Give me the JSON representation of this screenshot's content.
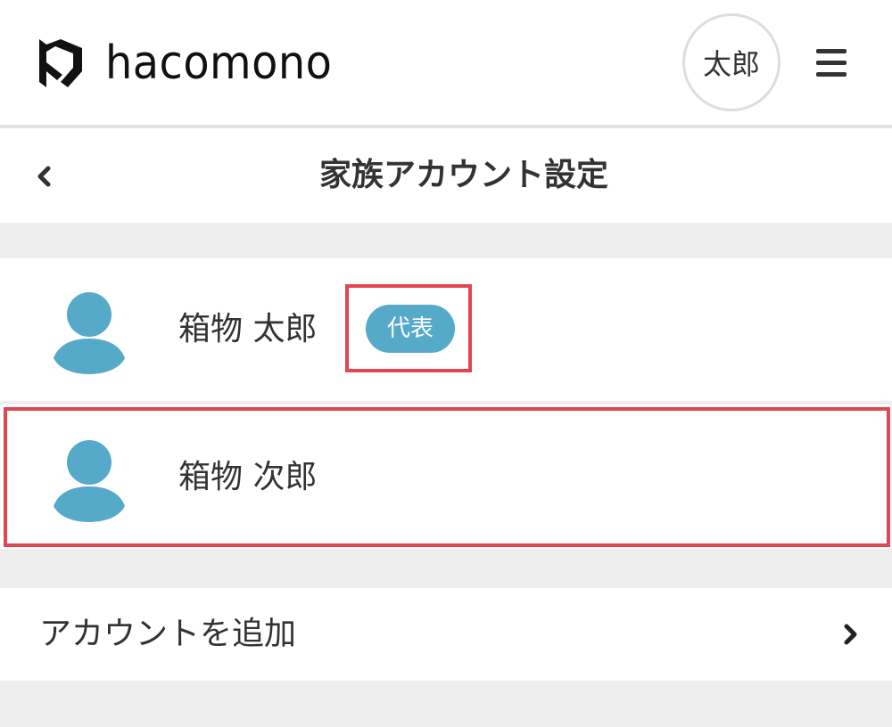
{
  "header": {
    "logo_text": "hacomono",
    "user_initials": "太郎"
  },
  "page": {
    "title": "家族アカウント設定"
  },
  "members": [
    {
      "name": "箱物 太郎",
      "badge": "代表"
    },
    {
      "name": "箱物 次郎"
    }
  ],
  "actions": {
    "add_account_label": "アカウントを追加"
  },
  "colors": {
    "accent": "#55a9c9",
    "highlight": "#e0474f",
    "text": "#333333",
    "background": "#eeeeee"
  },
  "icons": {
    "logo": "hacomono-logo-icon",
    "menu": "hamburger-menu-icon",
    "back": "chevron-left-icon",
    "member": "person-icon",
    "forward": "chevron-right-icon"
  }
}
